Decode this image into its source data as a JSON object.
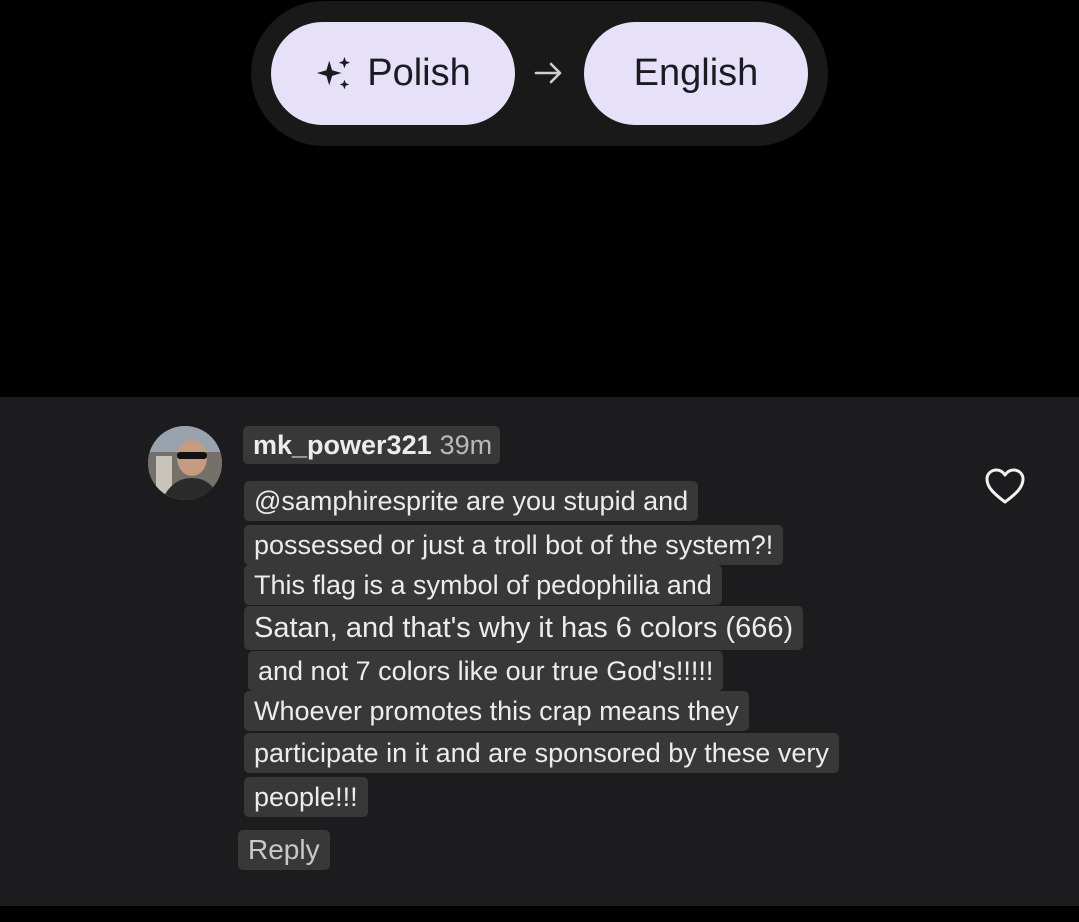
{
  "translate_bar": {
    "source_language": "Polish",
    "target_language": "English",
    "sparkle_icon": "sparkle-icon",
    "arrow_icon": "arrow-right-icon"
  },
  "comment": {
    "username": "mk_power321",
    "timestamp": "39m",
    "lines": [
      "@samphiresprite are you stupid and",
      "possessed or just a troll bot of the system?!",
      "This flag is a symbol of pedophilia and",
      "Satan, and that's why it has 6 colors (666)",
      "and not 7 colors like our true God's!!!!!",
      "Whoever promotes this crap means they",
      "participate in it and are sponsored by these very",
      "people!!!"
    ],
    "reply_label": "Reply",
    "like_icon": "heart-outline-icon"
  },
  "colors": {
    "pill_background": "#e6e1f8",
    "bar_background": "#191919",
    "panel_background": "#1c1c1e",
    "text_highlight": "#383838"
  }
}
